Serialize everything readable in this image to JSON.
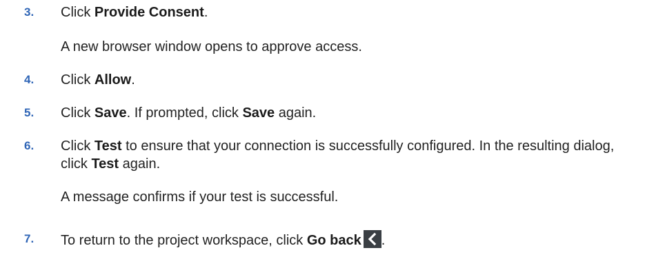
{
  "steps": [
    {
      "number": "3.",
      "before": "Click ",
      "bold": "Provide Consent",
      "after": ".",
      "note": "A new browser window opens to approve access."
    },
    {
      "number": "4.",
      "before": "Click ",
      "bold": "Allow",
      "after": "."
    },
    {
      "number": "5.",
      "before": "Click ",
      "bold": "Save",
      "middle": ". If prompted, click ",
      "bold2": "Save",
      "after": " again."
    },
    {
      "number": "6.",
      "before": "Click ",
      "bold": "Test",
      "middle": " to ensure that your connection is successfully configured. In the resulting dialog, click ",
      "bold2": "Test",
      "after": " again.",
      "note": "A message confirms if your test is successful."
    },
    {
      "number": "7.",
      "before": "To return to the project workspace, click ",
      "bold": "Go back",
      "icon": "chevron-left-icon",
      "after": "."
    }
  ]
}
